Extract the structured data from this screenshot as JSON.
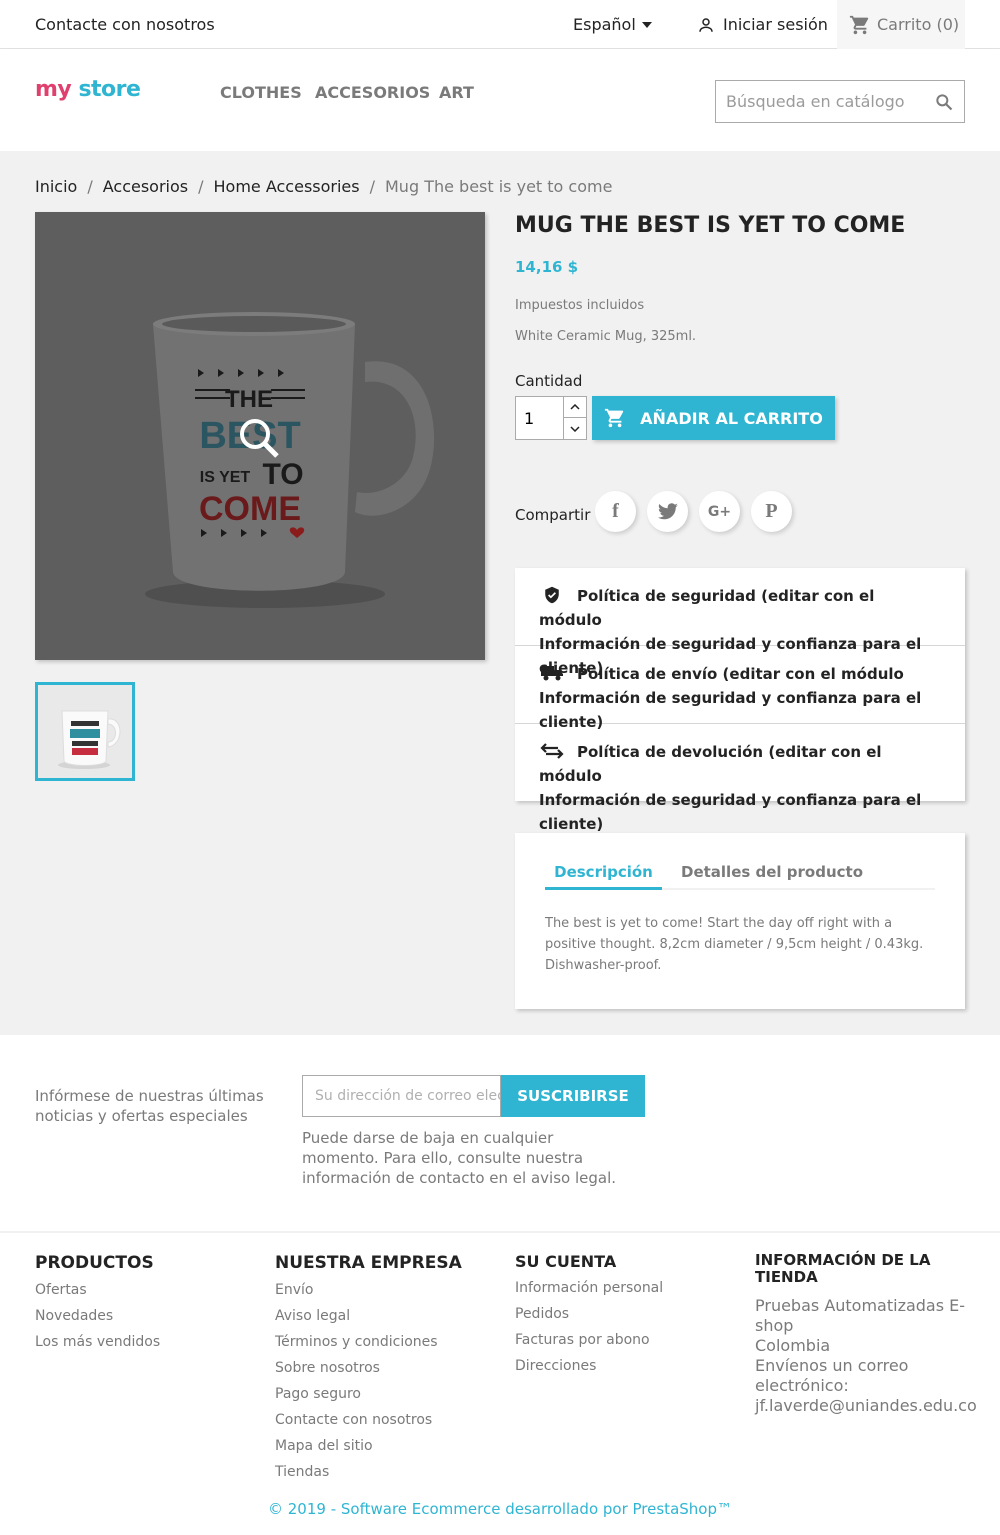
{
  "topbar": {
    "contact": "Contacte con nosotros",
    "language": "Español",
    "login": "Iniciar sesión",
    "cart": "Carrito (0)"
  },
  "header": {
    "logo": [
      "my",
      "store"
    ],
    "menu": [
      "CLOTHES",
      "ACCESORIOS",
      "ART"
    ],
    "search_placeholder": "Búsqueda en catálogo"
  },
  "breadcrumb": [
    "Inicio",
    "Accesorios",
    "Home Accessories",
    "Mug The best is yet to come"
  ],
  "product": {
    "title": "MUG THE BEST IS YET TO COME",
    "price": "14,16 $",
    "taxes": "Impuestos incluidos",
    "short_description": "White Ceramic Mug, 325ml.",
    "quantity_label": "Cantidad",
    "quantity_value": "1",
    "add_to_cart": "AÑADIR AL CARRITO",
    "share_label": "Compartir",
    "mug_print": [
      "THE",
      "BEST",
      "IS YET",
      "TO",
      "COME"
    ]
  },
  "reassurance": [
    {
      "icon": "shield-check-icon",
      "line1": "Política de seguridad (editar con el módulo",
      "line2": "Información de seguridad y confianza para el cliente)"
    },
    {
      "icon": "truck-icon",
      "line1": "Política de envío (editar con el módulo",
      "line2": "Información de seguridad y confianza para el cliente)"
    },
    {
      "icon": "swap-arrows-icon",
      "line1": "Política de devolución (editar con el módulo",
      "line2": "Información de seguridad y confianza para el cliente)"
    }
  ],
  "tabs": {
    "description_tab": "Descripción",
    "details_tab": "Detalles del producto",
    "description_text": "The best is yet to come! Start the day off right with a positive thought. 8,2cm diameter / 9,5cm height / 0.43kg. Dishwasher-proof."
  },
  "newsletter": {
    "text": "Infórmese de nuestras últimas noticias y ofertas especiales",
    "placeholder": "Su dirección de correo electrónico",
    "button": "SUSCRIBIRSE",
    "note": "Puede darse de baja en cualquier momento. Para ello, consulte nuestra información de contacto en el aviso legal."
  },
  "footer": {
    "products": {
      "title": "PRODUCTOS",
      "links": [
        "Ofertas",
        "Novedades",
        "Los más vendidos"
      ]
    },
    "company": {
      "title": "NUESTRA EMPRESA",
      "links": [
        "Envío",
        "Aviso legal",
        "Términos y condiciones",
        "Sobre nosotros",
        "Pago seguro",
        "Contacte con nosotros",
        "Mapa del sitio",
        "Tiendas"
      ]
    },
    "account": {
      "title": "SU CUENTA",
      "links": [
        "Información personal",
        "Pedidos",
        "Facturas por abono",
        "Direcciones"
      ]
    },
    "store": {
      "title_line1": "INFORMACIÓN DE LA",
      "title_line2": "TIENDA",
      "lines": [
        "Pruebas Automatizadas E-shop",
        "Colombia",
        "Envíenos un correo electrónico:",
        "jf.laverde@uniandes.edu.co"
      ]
    },
    "copyright": "© 2019 - Software Ecommerce desarrollado por PrestaShop™"
  },
  "colors": {
    "accent": "#2fb5d2",
    "text": "#232323",
    "muted": "#7a7a7a",
    "background": "#f1f1f1"
  }
}
